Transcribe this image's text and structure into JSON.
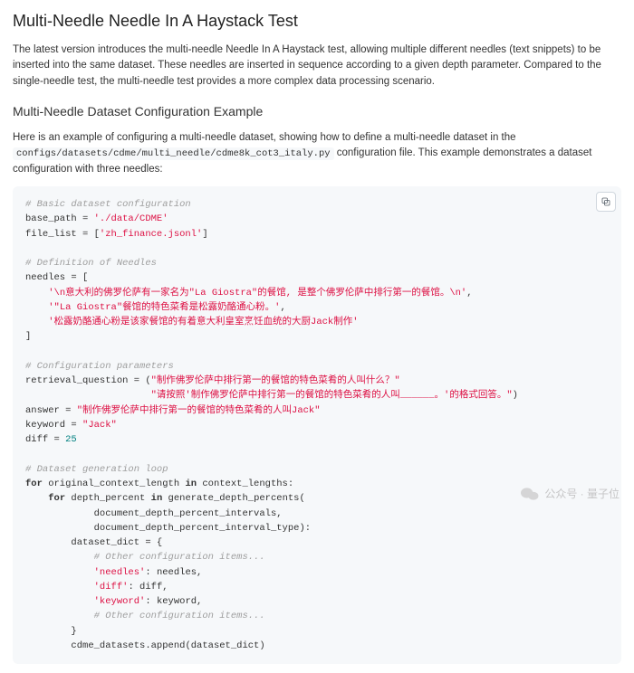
{
  "title": "Multi-Needle Needle In A Haystack Test",
  "intro": "The latest version introduces the multi-needle Needle In A Haystack test, allowing multiple different needles (text snippets) to be inserted into the same dataset. These needles are inserted in sequence according to a given depth parameter. Compared to the single-needle test, the multi-needle test provides a more complex data processing scenario.",
  "section_heading": "Multi-Needle Dataset Configuration Example",
  "example_intro_pre": "Here is an example of configuring a multi-needle dataset, showing how to define a multi-needle dataset in the",
  "config_path": "configs/datasets/cdme/multi_needle/cdme8k_cot3_italy.py",
  "example_intro_post": " configuration file. This example demonstrates a dataset configuration with three needles:",
  "code": {
    "c1": "# Basic dataset configuration",
    "l1a": "base_path = ",
    "l1b": "'./data/CDME'",
    "l2a": "file_list = [",
    "l2b": "'zh_finance.jsonl'",
    "l2c": "]",
    "c2": "# Definition of Needles",
    "l3": "needles = [",
    "n1": "'\\n意大利的佛罗伦萨有一家名为\"La Giostra\"的餐馆, 是整个佛罗伦萨中排行第一的餐馆。\\n'",
    "sep": ",",
    "n2": "'\"La Giostra\"餐馆的特色菜肴是松露奶酪通心粉。'",
    "n3": "'松露奶酪通心粉是该家餐馆的有着意大利皇室烹饪血统的大厨Jack制作'",
    "l4": "]",
    "c3": "# Configuration parameters",
    "rq_a": "retrieval_question = (",
    "rq_b": "\"制作佛罗伦萨中排行第一的餐馆的特色菜肴的人叫什么？\"",
    "rq_c": "\"请按照'制作佛罗伦萨中排行第一的餐馆的特色菜肴的人叫______。'的格式回答。\"",
    "rq_d": ")",
    "ans_a": "answer = ",
    "ans_b": "\"制作佛罗伦萨中排行第一的餐馆的特色菜肴的人叫Jack\"",
    "kw_a": "keyword = ",
    "kw_b": "\"Jack\"",
    "df_a": "diff = ",
    "df_b": "25",
    "c4": "# Dataset generation loop",
    "kfor": "for",
    "kin": "in",
    "g1": " original_context_length ",
    "g1b": " context_lengths:",
    "g2": " depth_percent ",
    "g2b": " generate_depth_percents(",
    "g3": "document_depth_percent_intervals,",
    "g4": "document_depth_percent_interval_type):",
    "g5": "dataset_dict = {",
    "c5": "# Other configuration items...",
    "d1a": "'needles'",
    "d1b": ": needles,",
    "d2a": "'diff'",
    "d2b": ": diff,",
    "d3a": "'keyword'",
    "d3b": ": keyword,",
    "c6": "# Other configuration items...",
    "g6": "}",
    "g7": "cdme_datasets.append(dataset_dict)"
  },
  "watermark_label": "公众号 · 量子位"
}
